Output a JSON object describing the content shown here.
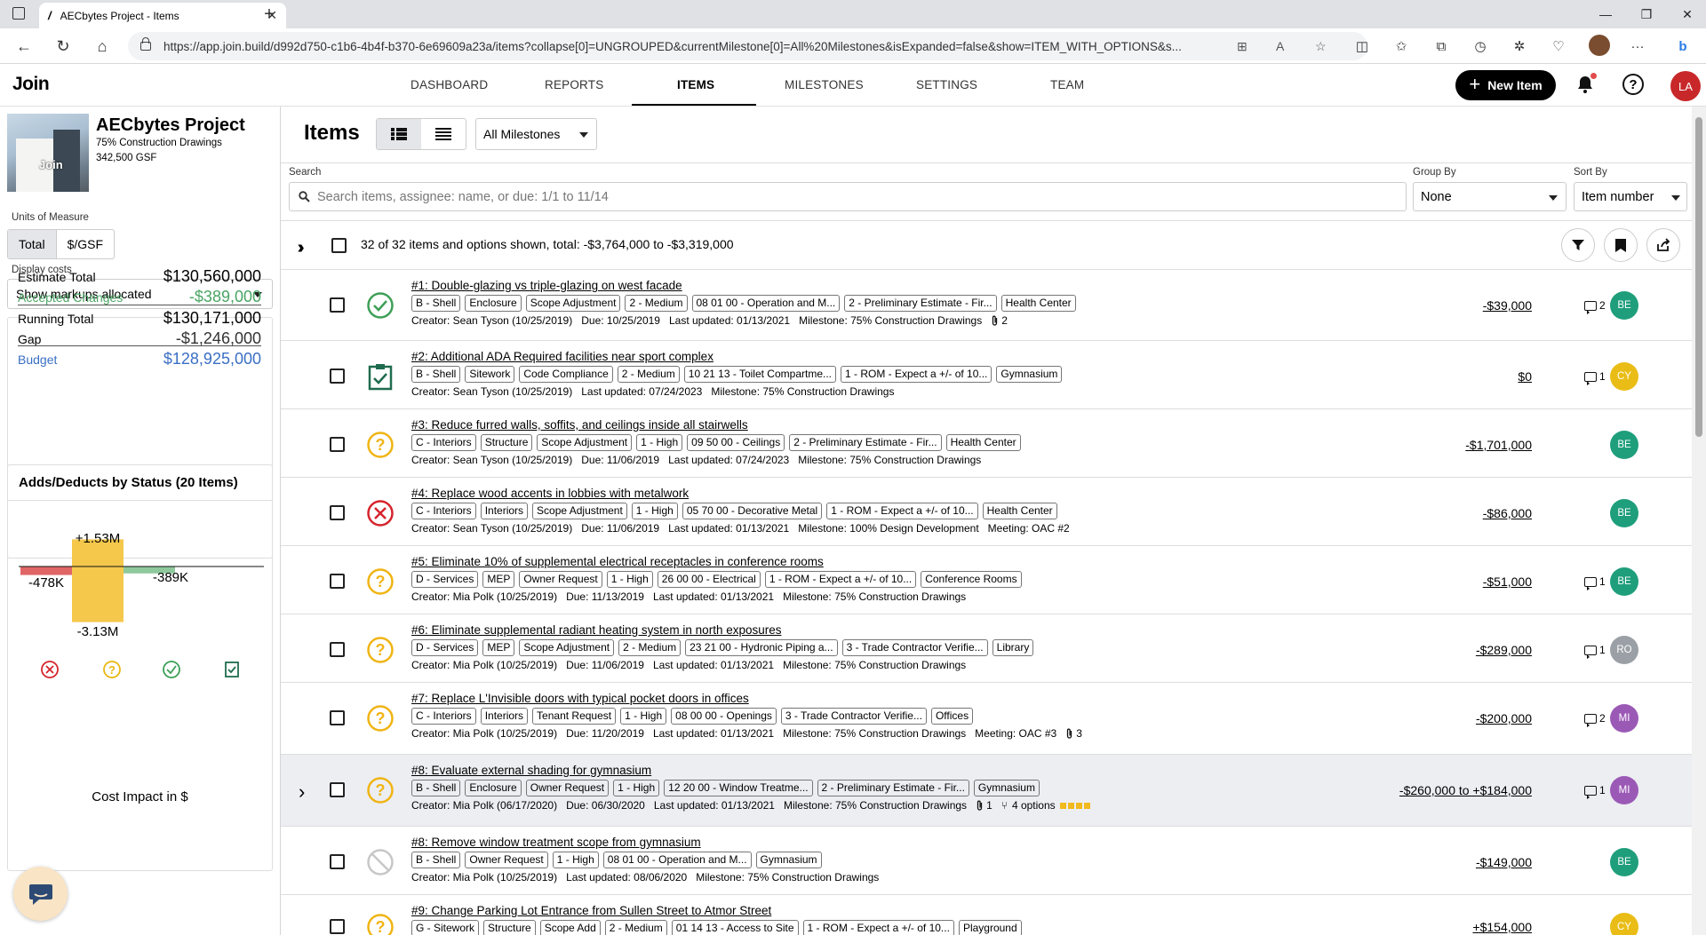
{
  "browser": {
    "tab_title": "AECbytes Project - Items",
    "url": "https://app.join.build/d992d750-c1b6-4b4f-b370-6e69609a23a/items?collapse[0]=UNGROUPED&currentMilestone[0]=All%20Milestones&isExpanded=false&show=ITEM_WITH_OPTIONS&s..."
  },
  "header": {
    "logo": "Join",
    "nav": [
      "DASHBOARD",
      "REPORTS",
      "ITEMS",
      "MILESTONES",
      "SETTINGS",
      "TEAM"
    ],
    "active_nav": "ITEMS",
    "new_item_label": "New Item",
    "user_initials": "LA"
  },
  "project": {
    "name": "AECbytes Project",
    "phase": "75% Construction Drawings",
    "gsf": "342,500 GSF",
    "thumb_watermark": "Join"
  },
  "sidebar": {
    "units_label": "Units of Measure",
    "units": [
      "Total",
      "$/GSF"
    ],
    "units_selected": "Total",
    "display_costs_label": "Display costs",
    "display_costs_value": "Show markups allocated",
    "totals": [
      {
        "label": "Estimate Total",
        "value": "$130,560,000",
        "color": "#000000"
      },
      {
        "label": "Accepted Changes",
        "value": "-$389,000",
        "color": "#4aa564"
      },
      {
        "label": "Running Total",
        "value": "$130,171,000",
        "color": "#000000"
      },
      {
        "label": "Gap",
        "value": "-$1,246,000",
        "color": "#333333"
      },
      {
        "label": "Budget",
        "value": "$128,925,000",
        "color": "#3a6fc4"
      }
    ]
  },
  "chart_data": {
    "type": "bar",
    "title": "Adds/Deducts by Status (20 Items)",
    "xlabel": "Cost Impact in $",
    "categories": [
      "Rejected",
      "Pending",
      "Accepted",
      "Incorporated"
    ],
    "series": [
      {
        "values": [
          0,
          1.53,
          0,
          0
        ],
        "color": "#f5c84c"
      },
      {
        "values": [
          -0.478,
          -3.13,
          -0.389,
          0
        ],
        "color": "#f5c84c"
      }
    ],
    "bar_colors": [
      "#e06666",
      "#f5c84c",
      "#8fc89c",
      "#1f7a5a"
    ],
    "data_labels": [
      "+1.53M",
      "-478K",
      "-3.13M",
      "-389K"
    ],
    "units": "millions $",
    "status_icons": [
      "rejected-icon",
      "pending-icon",
      "accepted-icon",
      "incorporated-icon"
    ]
  },
  "main": {
    "title": "Items",
    "milestone_filter": "All Milestones",
    "search_label": "Search",
    "search_placeholder": "Search items, assignee: name, or due: 1/1 to 11/14",
    "group_by_label": "Group By",
    "group_by_value": "None",
    "sort_by_label": "Sort By",
    "sort_by_value": "Item number",
    "summary": "32 of 32 items and options shown, total: -$3,764,000 to -$3,319,000"
  },
  "items": [
    {
      "title": "#1: Double-glazing vs triple-glazing on west facade",
      "status": "accepted",
      "tags": [
        "B - Shell",
        "Enclosure",
        "Scope Adjustment",
        "2 - Medium",
        "08 01 00 - Operation and M...",
        "2 - Preliminary Estimate - Fir...",
        "Health Center"
      ],
      "creator": "Creator: Sean Tyson (10/25/2019)",
      "due": "Due: 10/25/2019",
      "updated": "Last updated: 01/13/2021",
      "milestone": "Milestone: 75% Construction Drawings",
      "extra": "2",
      "extra_type": "attach",
      "cost": "-$39,000",
      "comments": "2",
      "assignee": "BE",
      "assignee_color": "#1f9e7c"
    },
    {
      "title": "#2: Additional ADA Required facilities near sport complex",
      "status": "incorporated",
      "tags": [
        "B - Shell",
        "Sitework",
        "Code Compliance",
        "2 - Medium",
        "10 21 13 - Toilet Compartme...",
        "1 - ROM - Expect a +/- of 10...",
        "Gymnasium"
      ],
      "creator": "Creator: Sean Tyson (10/25/2019)",
      "due": "",
      "updated": "Last updated: 07/24/2023",
      "milestone": "Milestone: 75% Construction Drawings",
      "extra": "",
      "extra_type": "",
      "cost": "$0",
      "comments": "1",
      "assignee": "CY",
      "assignee_color": "#e9bd16"
    },
    {
      "title": "#3: Reduce furred walls, soffits, and ceilings inside all stairwells",
      "status": "pending",
      "tags": [
        "C - Interiors",
        "Structure",
        "Scope Adjustment",
        "1 - High",
        "09 50 00 - Ceilings",
        "2 - Preliminary Estimate - Fir...",
        "Health Center"
      ],
      "creator": "Creator: Sean Tyson (10/25/2019)",
      "due": "Due: 11/06/2019",
      "updated": "Last updated: 07/24/2023",
      "milestone": "Milestone: 75% Construction Drawings",
      "extra": "",
      "extra_type": "",
      "cost": "-$1,701,000",
      "comments": "",
      "assignee": "BE",
      "assignee_color": "#1f9e7c"
    },
    {
      "title": "#4: Replace wood accents in lobbies with metalwork",
      "status": "rejected",
      "tags": [
        "C - Interiors",
        "Interiors",
        "Scope Adjustment",
        "1 - High",
        "05 70 00 - Decorative Metal",
        "1 - ROM - Expect a +/- of 10...",
        "Health Center"
      ],
      "creator": "Creator: Sean Tyson (10/25/2019)",
      "due": "Due: 11/06/2019",
      "updated": "Last updated: 01/13/2021",
      "milestone": "Milestone: 100% Design Development",
      "extra": "Meeting: OAC #2",
      "extra_type": "text",
      "cost": "-$86,000",
      "comments": "",
      "assignee": "BE",
      "assignee_color": "#1f9e7c"
    },
    {
      "title": "#5: Eliminate 10% of supplemental electrical receptacles in conference rooms",
      "status": "pending",
      "tags": [
        "D - Services",
        "MEP",
        "Owner Request",
        "1 - High",
        "26 00 00 - Electrical",
        "1 - ROM - Expect a +/- of 10...",
        "Conference Rooms"
      ],
      "creator": "Creator: Mia Polk (10/25/2019)",
      "due": "Due: 11/13/2019",
      "updated": "Last updated: 01/13/2021",
      "milestone": "Milestone: 75% Construction Drawings",
      "extra": "",
      "extra_type": "",
      "cost": "-$51,000",
      "comments": "1",
      "assignee": "BE",
      "assignee_color": "#1f9e7c"
    },
    {
      "title": "#6: Eliminate supplemental radiant heating system in north exposures",
      "status": "pending",
      "tags": [
        "D - Services",
        "MEP",
        "Scope Adjustment",
        "2 - Medium",
        "23 21 00 - Hydronic Piping a...",
        "3 - Trade Contractor Verifie...",
        "Library"
      ],
      "creator": "Creator: Mia Polk (10/25/2019)",
      "due": "Due: 11/06/2019",
      "updated": "Last updated: 01/13/2021",
      "milestone": "Milestone: 75% Construction Drawings",
      "extra": "",
      "extra_type": "",
      "cost": "-$289,000",
      "comments": "1",
      "assignee": "RO",
      "assignee_color": "#9aa0a6"
    },
    {
      "title": "#7: Replace L'Invisible doors with typical pocket doors in offices",
      "status": "pending",
      "tags": [
        "C - Interiors",
        "Interiors",
        "Tenant Request",
        "1 - High",
        "08 00 00 - Openings",
        "3 - Trade Contractor Verifie...",
        "Offices"
      ],
      "creator": "Creator: Mia Polk (10/25/2019)",
      "due": "Due: 11/20/2019",
      "updated": "Last updated: 01/13/2021",
      "milestone": "Milestone: 75% Construction Drawings",
      "extra": "Meeting: OAC #3",
      "extra_type": "text",
      "extra2": "3",
      "cost": "-$200,000",
      "comments": "2",
      "assignee": "MI",
      "assignee_color": "#9b59b6"
    },
    {
      "title": "#8: Evaluate external shading for gymnasium",
      "status": "pending",
      "tags": [
        "B - Shell",
        "Enclosure",
        "Owner Request",
        "1 - High",
        "12 20 00 - Window Treatme...",
        "2 - Preliminary Estimate - Fir...",
        "Gymnasium"
      ],
      "creator": "Creator: Mia Polk (06/17/2020)",
      "due": "Due: 06/30/2020",
      "updated": "Last updated: 01/13/2021",
      "milestone": "Milestone: 75% Construction Drawings",
      "extra": "1",
      "extra_type": "attach",
      "options": "4 options",
      "cost": "-$260,000 to +$184,000",
      "comments": "1",
      "assignee": "MI",
      "assignee_color": "#9b59b6"
    },
    {
      "title": "#8: Remove window treatment scope from gymnasium",
      "status": "notapplicable",
      "tags": [
        "B - Shell",
        "Owner Request",
        "1 - High",
        "08 01 00 - Operation and M...",
        "Gymnasium"
      ],
      "creator": "Creator: Mia Polk (10/25/2019)",
      "due": "",
      "updated": "Last updated: 08/06/2020",
      "milestone": "Milestone: 75% Construction Drawings",
      "extra": "",
      "extra_type": "",
      "cost": "-$149,000",
      "comments": "",
      "assignee": "BE",
      "assignee_color": "#1f9e7c"
    },
    {
      "title": "#9: Change Parking Lot Entrance from Sullen Street to Atmor Street",
      "status": "pending",
      "tags": [
        "G - Sitework",
        "Structure",
        "Scope Add",
        "2 - Medium",
        "01 14 13 - Access to Site",
        "1 - ROM - Expect a +/- of 10...",
        "Playground"
      ],
      "creator": "",
      "due": "",
      "updated": "",
      "milestone": "",
      "extra": "",
      "extra_type": "",
      "cost": "+$154,000",
      "comments": "",
      "assignee": "CY",
      "assignee_color": "#e9bd16"
    }
  ]
}
